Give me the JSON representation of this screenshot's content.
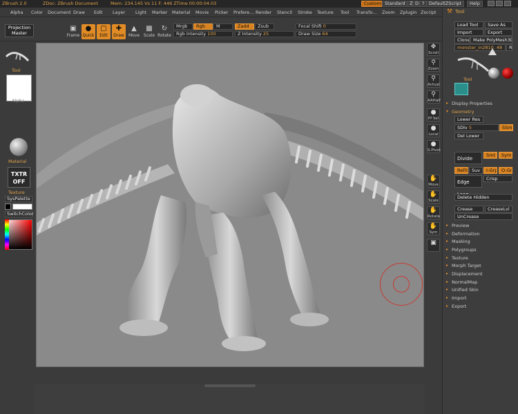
{
  "titlebar": {
    "app": "ZBrush 2.0",
    "document": "ZDoc: ZBrush Document",
    "stats": "Mem: 234.145  Vs 11  F: 446  ZTime 00:00:04.03",
    "custom": "Custom",
    "standard": "Standard",
    "z": "Z",
    "d": "D",
    "q": "?",
    "default": "DefaultZScript",
    "help": "Help"
  },
  "menus": [
    "Alpha",
    "Color",
    "Document",
    "Draw",
    "Edit",
    "Layer",
    "Light",
    "Marker",
    "Material",
    "Movie",
    "Picker",
    "Prefere...",
    "Render",
    "Stencil",
    "Stroke",
    "Texture",
    "Tool",
    "Transfo...",
    "Zoom",
    "Zplugin",
    "Zscript"
  ],
  "toolbar": {
    "projection_master": "Projection Master",
    "frame": "Frame",
    "quick": "Quick",
    "edit": "Edit",
    "draw": "Draw",
    "move": "Move",
    "scale": "Scale",
    "rotate": "Rotate",
    "mrgb": "Mrgb",
    "rgb": "Rgb",
    "m": "M",
    "rgb_intensity_label": "Rgb Intensity",
    "rgb_intensity_value": "100",
    "zadd": "Zadd",
    "zsub": "Zsub",
    "z_intensity_label": "Z Intensity",
    "z_intensity_value": "25",
    "focal_shift_label": "Focal Shift",
    "focal_shift_value": "0",
    "draw_size_label": "Draw Size",
    "draw_size_value": "64"
  },
  "left_shelf": {
    "tool": "Tool",
    "alpha": "Alpha",
    "material": "Material",
    "txtr_off": "TXTR OFF",
    "texture": "Texture",
    "syspalette": "SysPalette",
    "switchcolor": "SwitchColor"
  },
  "right_shelf": [
    "Scroll",
    "Zoom",
    "Actual",
    "AAHalf",
    "Pf Sel",
    "Local",
    "S.Pivot",
    "Move",
    "Scale",
    "Rotate",
    "Sym"
  ],
  "palette": {
    "title": "Tool",
    "load_tool": "Load Tool",
    "save_as": "Save As",
    "import": "Import",
    "export": "Export",
    "clone": "Clone",
    "make_polymesh": "Make PolyMesh3D",
    "tool_name": "monster_in2810. 48",
    "r_btn": "R",
    "tool_label": "Tool",
    "display_properties": "Display Properties",
    "geometry": "Geometry",
    "lower_res": "Lower Res",
    "sdiv_label": "SDiv",
    "sdiv_value": "5",
    "smt_badge": "SSmt",
    "del_lower": "Del Lower",
    "divide": "Divide",
    "smt": "Smt",
    "sym": "Sym",
    "refit": "ReFit",
    "suv": "Suv",
    "igrp": "I-Grp",
    "ogrp": "O-Grp",
    "edge_loop": "Edge Loop",
    "crisp": "Crisp",
    "delete_hidden": "Delete Hidden",
    "crease": "Crease",
    "crease_lvl": "CreaseLvl",
    "uncrease": "UnCrease",
    "sections": [
      "Preview",
      "Deformation",
      "Masking",
      "Polygroups",
      "Texture",
      "Morph Target",
      "Displacement",
      "NormalMap",
      "Unified Skin",
      "Import",
      "Export"
    ]
  },
  "colors": {
    "accent": "#e08b25",
    "panel": "#3d3d3d",
    "canvas": "#8a8a8a"
  }
}
